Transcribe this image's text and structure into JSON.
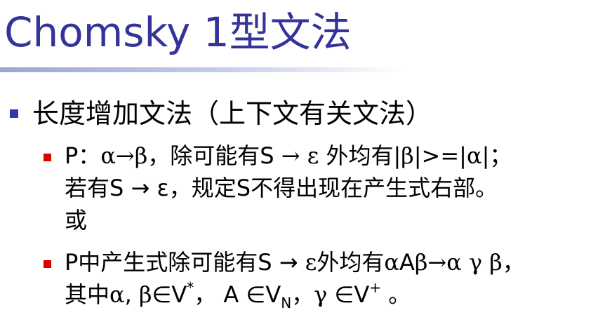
{
  "title": "Chomsky 1型文法",
  "bullets": [
    {
      "text": "长度增加文法（上下文有关文法）",
      "children": [
        {
          "line1_prefix": "P：",
          "alpha": "α",
          "arrow": "→",
          "beta": "β",
          "comma_after": "，除可能有",
          "S": "S",
          "arrow2": " → ",
          "epsilon": "ε",
          "rest": " 外均有|",
          "beta2": "β",
          "ge": "|>=|",
          "alpha2": "α",
          "end": "|；",
          "line2": "若有S → ε，规定S不得出现在产生式右部。",
          "line3": "或"
        },
        {
          "line1_a": "P中产生式除可能有S → ",
          "epsilon": "ε",
          "line1_b": "外均有",
          "alpha": "α",
          "A": "A",
          "beta": "β",
          "arrow": "→",
          "alpha2": "α",
          "gamma": "γ",
          "beta2": "β",
          "comma": "，",
          "line2_a": "其中",
          "alpha3": "α",
          "comma2": ", ",
          "beta3": "β",
          "in1": "∈V",
          "star": "*",
          "sep1": "，  A ",
          "in2": "∈V",
          "subN": "N",
          "sep2": "，",
          "gamma2": "γ",
          "in3": " ∈V",
          "plus": "+",
          "end": " 。"
        }
      ]
    }
  ],
  "colors": {
    "title": "#333399",
    "bullet_l1": "#3333aa",
    "bullet_l2": "#dd0000"
  }
}
